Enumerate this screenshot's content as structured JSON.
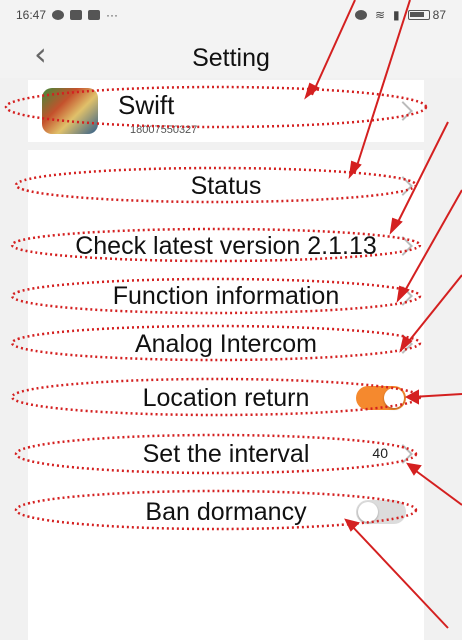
{
  "status_bar": {
    "time": "16:47",
    "battery": "87"
  },
  "header": {
    "back_icon": "chevron-left-icon",
    "title": "Setting"
  },
  "profile": {
    "name": "Swift",
    "phone": "18007550327"
  },
  "settings": {
    "status": "Status",
    "check_version": "Check latest version 2.1.13",
    "function_info": "Function information",
    "analog_intercom": "Analog Intercom",
    "location_return": "Location return",
    "location_return_on": true,
    "set_interval": "Set the interval",
    "interval_value": "40",
    "ban_dormancy": "Ban dormancy",
    "ban_dormancy_on": false
  },
  "colors": {
    "toggle_on": "#f5892e",
    "annotation": "#d42020"
  }
}
